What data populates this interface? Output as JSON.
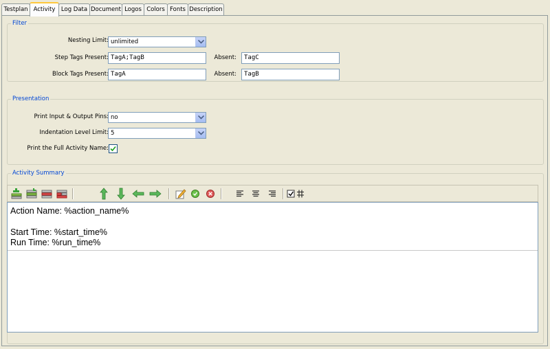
{
  "tabs": [
    {
      "label": "Testplan",
      "active": false
    },
    {
      "label": "Activity",
      "active": true
    },
    {
      "label": "Log Data",
      "active": false
    },
    {
      "label": "Document",
      "active": false
    },
    {
      "label": "Logos",
      "active": false
    },
    {
      "label": "Colors",
      "active": false
    },
    {
      "label": "Fonts",
      "active": false
    },
    {
      "label": "Description",
      "active": false
    }
  ],
  "filter": {
    "title": "Filter",
    "nesting_limit_label": "Nesting Limit:",
    "nesting_limit_value": "unlimited",
    "step_tags_label": "Step Tags Present:",
    "step_tags_value": "TagA;TagB",
    "step_absent_label": "Absent:",
    "step_absent_value": "TagC",
    "block_tags_label": "Block Tags Present:",
    "block_tags_value": "TagA",
    "block_absent_label": "Absent:",
    "block_absent_value": "TagB"
  },
  "presentation": {
    "title": "Presentation",
    "pins_label": "Print Input & Output Pins:",
    "pins_value": "no",
    "indent_label": "Indentation Level Limit:",
    "indent_value": "5",
    "full_name_label": "Print the Full Activity Name:",
    "full_name_checked": true
  },
  "summary": {
    "title": "Activity Summary",
    "toolbar_icons": [
      "add-row-icon",
      "insert-row-icon",
      "delete-row-icon",
      "remove-rows-icon",
      "move-up-icon",
      "move-down-icon",
      "move-left-icon",
      "move-right-icon",
      "edit-icon",
      "accept-icon",
      "reject-icon",
      "align-left-icon",
      "align-center-icon",
      "align-right-icon",
      "show-grid-checkbox-icon"
    ],
    "lines": [
      "Action Name: %action_name%",
      "",
      "Start Time: %start_time%",
      "Run Time: %run_time%"
    ]
  },
  "colors": {
    "accent": "#0046d5",
    "tab_highlight": "#ffc83c",
    "background": "#ece9d8"
  }
}
